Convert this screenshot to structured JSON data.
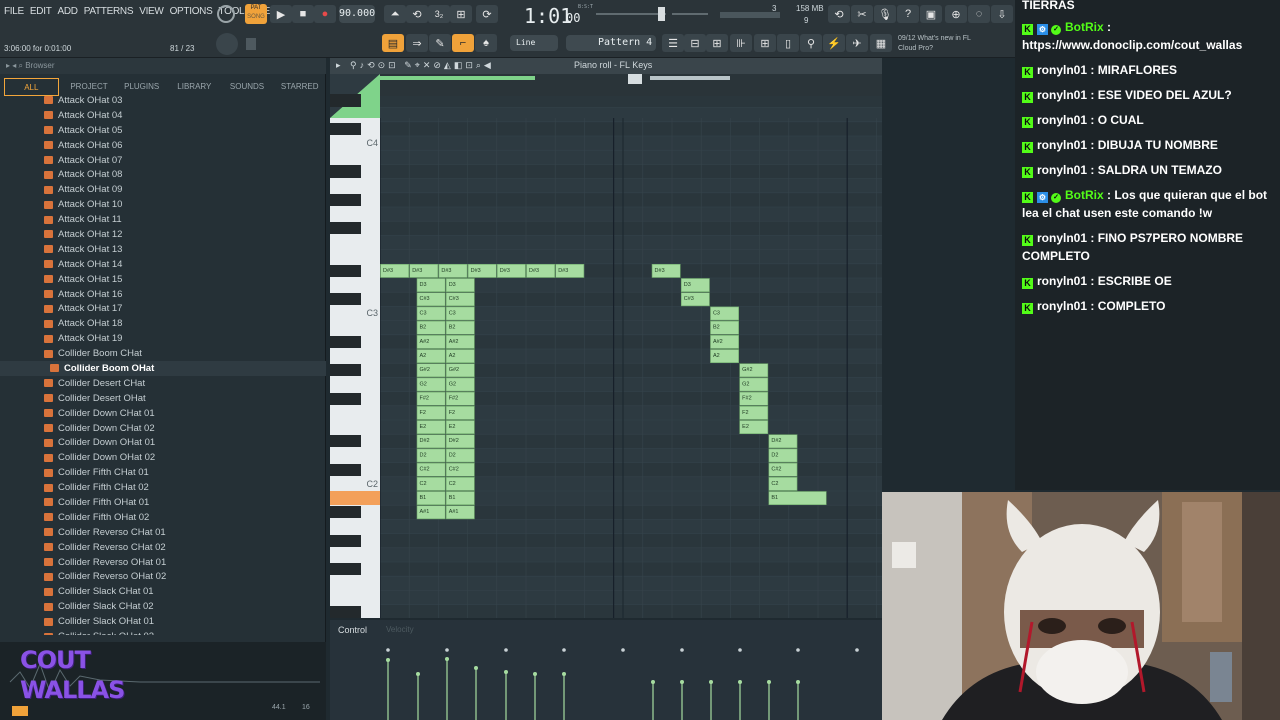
{
  "menu": [
    "FILE",
    "EDIT",
    "ADD",
    "PATTERNS",
    "VIEW",
    "OPTIONS",
    "TOOLS",
    "HELP"
  ],
  "transport": {
    "pat_label": "PAT",
    "song_label": "SONG",
    "tempo": "90.000",
    "time": "1:01",
    "time_ticks": "00",
    "bst": "B:S:T",
    "cpu_value": "3",
    "memory": "158 MB",
    "voices": "9"
  },
  "hint": {
    "position": "3:06:00 for 0:01:00",
    "counter": "81 / 23"
  },
  "toolbar2": {
    "snap_mode": "Line",
    "pattern": "Pattern 4",
    "news": "09/12  What's new in FL",
    "news2": "Cloud Pro?"
  },
  "browser": {
    "title": "Browser",
    "tabs": [
      "ALL",
      "PROJECT",
      "PLUGINS",
      "LIBRARY",
      "SOUNDS",
      "STARRED"
    ],
    "items": [
      "Attack OHat 03",
      "Attack OHat 04",
      "Attack OHat 05",
      "Attack OHat 06",
      "Attack OHat 07",
      "Attack OHat 08",
      "Attack OHat 09",
      "Attack OHat 10",
      "Attack OHat 11",
      "Attack OHat 12",
      "Attack OHat 13",
      "Attack OHat 14",
      "Attack OHat 15",
      "Attack OHat 16",
      "Attack OHat 17",
      "Attack OHat 18",
      "Attack OHat 19",
      "Collider Boom CHat",
      "Collider Boom OHat",
      "Collider Desert CHat",
      "Collider Desert OHat",
      "Collider Down CHat 01",
      "Collider Down CHat 02",
      "Collider Down OHat 01",
      "Collider Down OHat 02",
      "Collider Fifth CHat 01",
      "Collider Fifth CHat 02",
      "Collider Fifth OHat 01",
      "Collider Fifth OHat 02",
      "Collider Reverso CHat 01",
      "Collider Reverso CHat 02",
      "Collider Reverso OHat 01",
      "Collider Reverso OHat 02",
      "Collider Slack CHat 01",
      "Collider Slack CHat 02",
      "Collider Slack OHat 01",
      "Collider Slack OHat 02"
    ],
    "selected_index": 18,
    "logo_line1": "COUT",
    "logo_line2": "WALLAS",
    "sample_info": "44.1",
    "sample_info2": "16"
  },
  "piano_roll": {
    "title": "Piano roll - FL Keys",
    "octave_labels": [
      "C4",
      "C3",
      "C2"
    ],
    "control_label": "Control",
    "control_sub": "Velocity"
  },
  "notes_group1_labels": [
    "D#3",
    "D3",
    "C#3",
    "C3",
    "B2",
    "A#2",
    "A2",
    "G#2",
    "G2",
    "F#2",
    "F2",
    "E2",
    "D#2",
    "D2",
    "C#2",
    "C2",
    "B1",
    "A#1"
  ],
  "notes_row_top": [
    "D#3",
    "D#3",
    "D#3",
    "D#3",
    "D#3",
    "D#3",
    "D#3"
  ],
  "notes_group2_labels": [
    "D#3",
    "D3",
    "C#3",
    "C3",
    "B2",
    "A#2",
    "A2",
    "G#2",
    "G2",
    "F#2",
    "F2",
    "E2",
    "D#2",
    "D2",
    "C#2",
    "C2",
    "B1"
  ],
  "chat": {
    "header": "TIERRAS",
    "messages": [
      {
        "user": "BotRix",
        "bot": true,
        "text": ": https://www.donoclip.com/cout_wallas"
      },
      {
        "user": "ronyln01",
        "bot": false,
        "text": ": MIRAFLORES"
      },
      {
        "user": "ronyln01",
        "bot": false,
        "text": ": ESE VIDEO DEL AZUL?"
      },
      {
        "user": "ronyln01",
        "bot": false,
        "text": ": O CUAL"
      },
      {
        "user": "ronyln01",
        "bot": false,
        "text": ": DIBUJA TU NOMBRE"
      },
      {
        "user": "ronyln01",
        "bot": false,
        "text": ": SALDRA UN TEMAZO"
      },
      {
        "user": "BotRix",
        "bot": true,
        "text": ": Los que quieran que el bot lea el chat usen este comando !w"
      },
      {
        "user": "ronyln01",
        "bot": false,
        "text": ": FINO PS7PERO NOMBRE COMPLETO"
      },
      {
        "user": "ronyln01",
        "bot": false,
        "text": ": ESCRIBE OE"
      },
      {
        "user": "ronyln01",
        "bot": false,
        "text": ": COMPLETO"
      }
    ]
  },
  "colors": {
    "accent": "#f3a63b",
    "note_fill": "#a6dca0",
    "kick_green": "#53fc18"
  }
}
